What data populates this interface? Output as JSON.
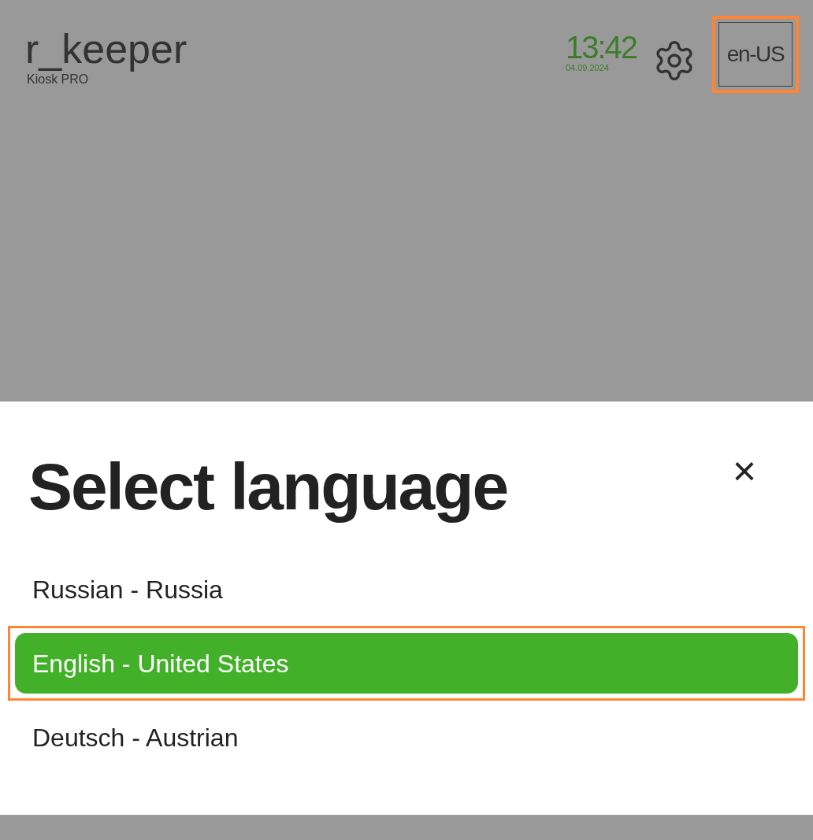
{
  "header": {
    "logo": "r_keeper",
    "subtitle": "Kiosk PRO",
    "time": "13:42",
    "date": "04.09.2024",
    "language_button": "en-US"
  },
  "dialog": {
    "title": "Select language",
    "close": "×",
    "languages": [
      {
        "label": "Russian - Russia",
        "selected": false
      },
      {
        "label": "English - United States",
        "selected": true
      },
      {
        "label": "Deutsch - Austrian",
        "selected": false
      }
    ]
  }
}
